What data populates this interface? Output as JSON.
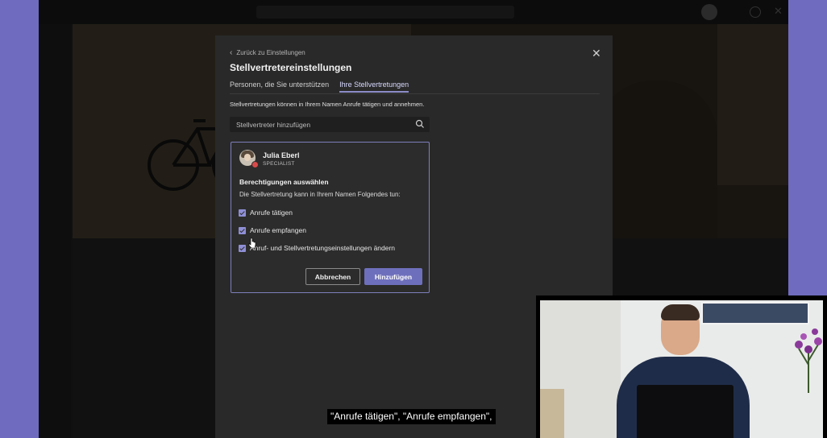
{
  "dialog": {
    "back_label": "Zurück zu Einstellungen",
    "title": "Stellvertretereinstellungen",
    "tabs": [
      {
        "label": "Personen, die Sie unterstützen",
        "active": false
      },
      {
        "label": "Ihre Stellvertretungen",
        "active": true
      }
    ],
    "description": "Stellvertretungen können in Ihrem Namen Anrufe tätigen und annehmen.",
    "search_placeholder": "Stellvertreter hinzufügen",
    "delegate": {
      "name": "Julia Eberl",
      "role": "SPECIALIST",
      "presence": "busy"
    },
    "permissions_title": "Berechtigungen auswählen",
    "permissions_desc": "Die Stellvertretung kann in Ihrem Namen Folgendes tun:",
    "permissions": [
      {
        "label": "Anrufe tätigen",
        "checked": true
      },
      {
        "label": "Anrufe empfangen",
        "checked": true
      },
      {
        "label": "Anruf- und Stellvertretungseinstellungen ändern",
        "checked": true
      }
    ],
    "cancel_label": "Abbrechen",
    "add_label": "Hinzufügen"
  },
  "caption": "\"Anrufe tätigen\", \"Anrufe empfangen\",",
  "colors": {
    "accent": "#6e6fbc",
    "dialog_bg": "#292929",
    "page_frame": "#6f6cbf"
  }
}
